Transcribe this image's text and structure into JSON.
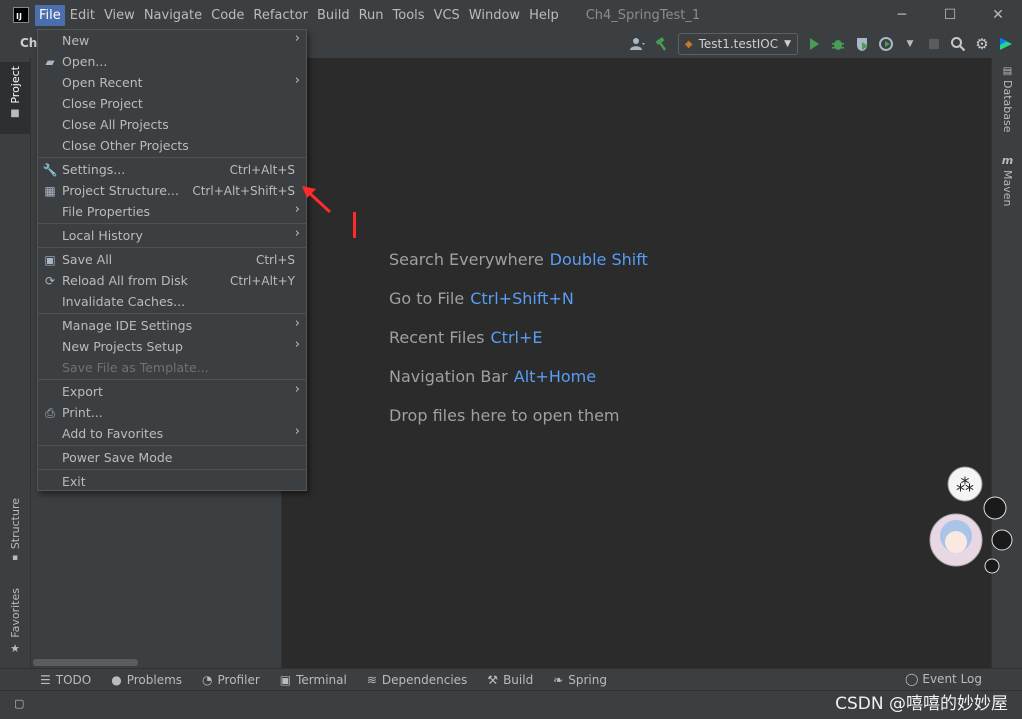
{
  "window": {
    "title": "Ch4_SpringTest_1",
    "logo_text": "IJ",
    "controls": [
      "─",
      "☐",
      "✕"
    ]
  },
  "menubar": {
    "items": [
      "File",
      "Edit",
      "View",
      "Navigate",
      "Code",
      "Refactor",
      "Build",
      "Run",
      "Tools",
      "VCS",
      "Window",
      "Help"
    ],
    "active": "File"
  },
  "toolbar": {
    "project_tab_label": "Ch",
    "run_config": "Test1.testIOC"
  },
  "file_menu": {
    "items": [
      {
        "label": "New",
        "submenu": true,
        "icon": ""
      },
      {
        "label": "Open...",
        "icon": "folder-icon"
      },
      {
        "label": "Open Recent",
        "submenu": true
      },
      {
        "label": "Close Project"
      },
      {
        "label": "Close All Projects"
      },
      {
        "label": "Close Other Projects"
      },
      {
        "separator": true
      },
      {
        "label": "Settings...",
        "shortcut": "Ctrl+Alt+S",
        "icon": "wrench-icon"
      },
      {
        "label": "Project Structure...",
        "shortcut": "Ctrl+Alt+Shift+S",
        "icon": "project-structure-icon"
      },
      {
        "label": "File Properties",
        "submenu": true
      },
      {
        "separator": true
      },
      {
        "label": "Local History",
        "submenu": true
      },
      {
        "separator": true
      },
      {
        "label": "Save All",
        "shortcut": "Ctrl+S",
        "icon": "save-icon"
      },
      {
        "label": "Reload All from Disk",
        "shortcut": "Ctrl+Alt+Y",
        "icon": "reload-icon"
      },
      {
        "label": "Invalidate Caches..."
      },
      {
        "separator": true
      },
      {
        "label": "Manage IDE Settings",
        "submenu": true
      },
      {
        "label": "New Projects Setup",
        "submenu": true
      },
      {
        "label": "Save File as Template...",
        "disabled": true
      },
      {
        "separator": true
      },
      {
        "label": "Export",
        "submenu": true
      },
      {
        "label": "Print...",
        "icon": "print-icon"
      },
      {
        "label": "Add to Favorites",
        "submenu": true
      },
      {
        "separator": true
      },
      {
        "label": "Power Save Mode"
      },
      {
        "separator": true
      },
      {
        "label": "Exit"
      }
    ]
  },
  "left_tabs": {
    "project": "Project",
    "structure": "Structure",
    "favorites": "Favorites"
  },
  "right_tabs": {
    "database": "Database",
    "maven": "Maven"
  },
  "editor_hints": [
    {
      "text": "Search Everywhere",
      "key": "Double Shift"
    },
    {
      "text": "Go to File",
      "key": "Ctrl+Shift+N"
    },
    {
      "text": "Recent Files",
      "key": "Ctrl+E"
    },
    {
      "text": "Navigation Bar",
      "key": "Alt+Home"
    },
    {
      "text": "Drop files here to open them",
      "key": ""
    }
  ],
  "bottom_tools": [
    "TODO",
    "Problems",
    "Profiler",
    "Terminal",
    "Dependencies",
    "Build",
    "Spring"
  ],
  "event_log": "Event Log",
  "watermark": "CSDN @嘻嘻的妙妙屋",
  "colors": {
    "accent": "#4b6eaf",
    "shortcut_key": "#589df6",
    "annotation_red": "#ff2a2a"
  }
}
